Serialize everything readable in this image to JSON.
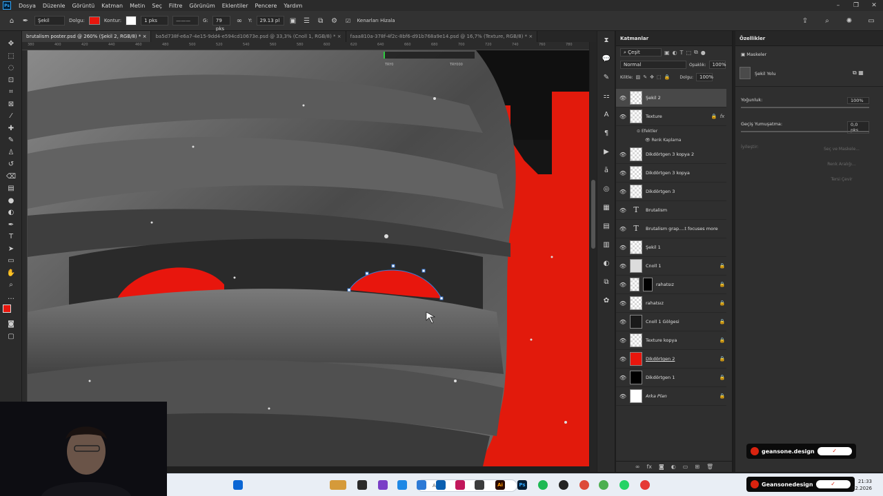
{
  "app": {
    "menu": [
      "Dosya",
      "Düzenle",
      "Görüntü",
      "Katman",
      "Metin",
      "Seç",
      "Filtre",
      "Görünüm",
      "Eklentiler",
      "Pencere",
      "Yardım"
    ]
  },
  "options_bar": {
    "shape_mode": "Şekil",
    "fill_label": "Dolgu:",
    "stroke_label": "Kontur:",
    "stroke_width": "1 pks",
    "w_label": "G:",
    "w_value": "79 pks",
    "h_label": "Y:",
    "h_value": "29.13 pl",
    "align_edges": "Kenarları Hizala",
    "fill_color": "#e8160d"
  },
  "tabs": [
    {
      "label": "brutalism poster.psd @ 260% (Şekil 2, RGB/8) *",
      "active": true
    },
    {
      "label": "ba5d738f-e6a7-4e15-9dd4-e594cd10673e.psd @ 33,3% (Cnoll 1, RGB/8) *",
      "active": false
    },
    {
      "label": "faaa810a-378f-4f2c-8bf6-d91b768a9e14.psd @ 16,7% (Texture, RGB/8) *",
      "active": false
    }
  ],
  "ruler": [
    "380",
    "400",
    "420",
    "440",
    "460",
    "480",
    "500",
    "520",
    "540",
    "560",
    "580",
    "600",
    "620",
    "640",
    "660",
    "680",
    "700",
    "720",
    "740",
    "760",
    "780"
  ],
  "canvas": {
    "overlay_label": "TRY0",
    "overlay_label2": "TRY000"
  },
  "layers_panel": {
    "title": "Katmanlar",
    "filter": "Çeşit",
    "blend_mode": "Normal",
    "opacity_label": "Opaklık:",
    "opacity": "100%",
    "lock_label": "Kilitle:",
    "fill_label": "Dolgu:",
    "fill": "100%",
    "layers": [
      {
        "name": "Şekil 2",
        "type": "shape",
        "selected": true,
        "locked": false
      },
      {
        "name": "Texture",
        "type": "raster",
        "selected": false,
        "locked": true,
        "fx": true
      },
      {
        "name": "Dikdörtgen 3 kopya 2",
        "type": "shape",
        "selected": false,
        "locked": false
      },
      {
        "name": "Dikdörtgen 3 kopya",
        "type": "shape",
        "selected": false,
        "locked": false
      },
      {
        "name": "Dikdörtgen 3",
        "type": "shape",
        "selected": false,
        "locked": false
      },
      {
        "name": "Brutalism",
        "type": "text",
        "selected": false,
        "locked": false
      },
      {
        "name": "Brutalism grap....t focuses more",
        "type": "text",
        "selected": false,
        "locked": false
      },
      {
        "name": "Şekil 1",
        "type": "shape",
        "selected": false,
        "locked": false
      },
      {
        "name": "Cnoll 1",
        "type": "raster",
        "selected": false,
        "locked": true
      },
      {
        "name": "rahatsız",
        "type": "mask",
        "selected": false,
        "locked": true
      },
      {
        "name": "rahatsız",
        "type": "raster",
        "selected": false,
        "locked": true
      },
      {
        "name": "Cnoll 1 Gölgesi",
        "type": "raster",
        "selected": false,
        "locked": true
      },
      {
        "name": "Texture kopya",
        "type": "raster",
        "selected": false,
        "locked": true
      },
      {
        "name": "Dikdörtgen 2",
        "type": "shape",
        "selected": false,
        "locked": true
      },
      {
        "name": "Dikdörtgen 1",
        "type": "shape",
        "selected": false,
        "locked": true
      },
      {
        "name": "Arka Plan",
        "type": "background",
        "selected": false,
        "locked": true
      }
    ],
    "effects_label": "Efektler",
    "effect_name": "Renk Kaplama"
  },
  "properties_panel": {
    "title": "Özellikler",
    "masks_label": "Maskeler",
    "shape_path": "Şekil Yolu",
    "density_label": "Yoğunluk:",
    "density_value": "100%",
    "feather_label": "Geçiş Yumuşatma:",
    "feather_value": "0,0 pks",
    "refine_label": "İyileştir:",
    "btn_select_mask": "Seç ve Maskele...",
    "btn_color_range": "Renk Aralığı...",
    "btn_invert": "Tersi Çevir"
  },
  "watermarks": [
    "geansone.design",
    "Geansonedesign"
  ],
  "taskbar": {
    "search_placeholder": "Ara",
    "time": "21:33",
    "date": "02.2026"
  }
}
